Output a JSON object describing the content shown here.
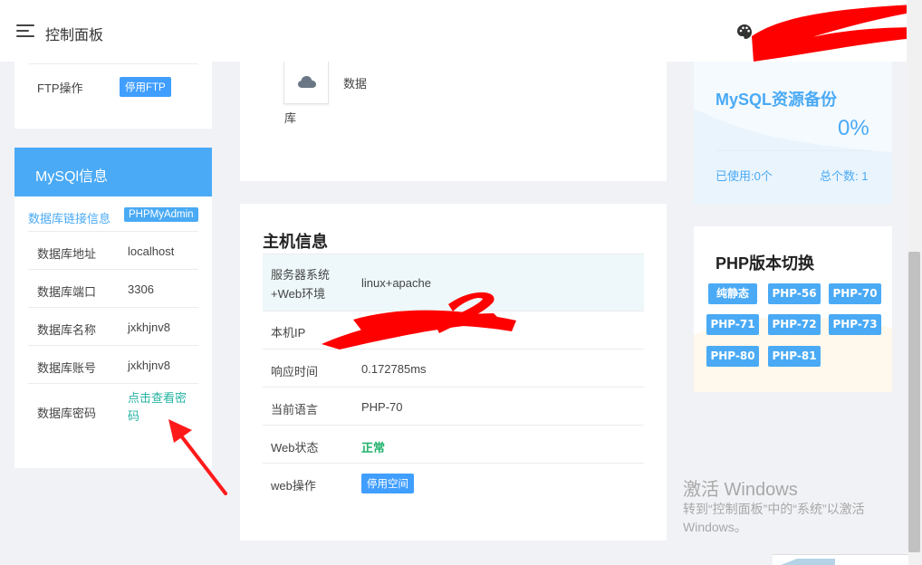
{
  "header": {
    "title": "控制面板",
    "menu_icon": "hamburger-menu-icon",
    "theme_icon": "palette-icon"
  },
  "ftp": {
    "label": "FTP操作",
    "button": "停用FTP"
  },
  "mysql": {
    "title": "MySQl信息",
    "link_label": "数据库链接信息",
    "phpmyadmin_button": "PHPMyAdmin",
    "rows": [
      {
        "label": "数据库地址",
        "value": "localhost"
      },
      {
        "label": "数据库端口",
        "value": "3306"
      },
      {
        "label": "数据库名称",
        "value": "jxkhjnv8"
      },
      {
        "label": "数据库账号",
        "value": "jxkhjnv8"
      }
    ],
    "password_label": "数据库密码",
    "password_link": "点击查看密码"
  },
  "data_widget": {
    "icon": "cloud-icon",
    "label_part1": "数据",
    "label_part2": "库"
  },
  "host": {
    "title": "主机信息",
    "rows": [
      {
        "label": "服务器系统+Web环境",
        "value": "linux+apache"
      },
      {
        "label": "本机IP",
        "value": ""
      },
      {
        "label": "响应时间",
        "value": "0.172785ms"
      },
      {
        "label": "当前语言",
        "value": "PHP-70"
      },
      {
        "label": "Web状态",
        "value": "正常"
      },
      {
        "label": "web操作",
        "value": "停用空间"
      }
    ]
  },
  "backup": {
    "title": "MySQL资源备份",
    "percent": "0%",
    "used": "已使用:0个",
    "total": "总个数: 1"
  },
  "php_switch": {
    "title": "PHP版本切换",
    "buttons": [
      "纯静态",
      "PHP-56",
      "PHP-70",
      "PHP-71",
      "PHP-72",
      "PHP-73",
      "PHP-80",
      "PHP-81"
    ]
  },
  "watermark": {
    "title": "激活 Windows",
    "subtitle": "转到“控制面板”中的“系统”以激活 Windows。"
  },
  "colors": {
    "accent": "#4aaaf5",
    "link": "#26b3a3",
    "ok": "#20b26c",
    "redaction": "#ff0000"
  }
}
